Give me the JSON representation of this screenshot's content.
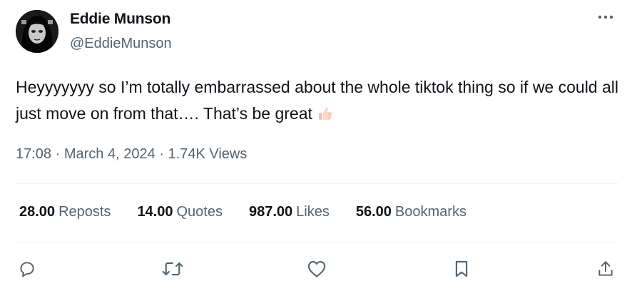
{
  "author": {
    "display_name": "Eddie Munson",
    "handle": "@EddieMunson",
    "avatar": "avatar-image"
  },
  "tweet": {
    "text": "Heyyyyyyy so I’m totally embarrassed about the whole tiktok thing so if we could all just move on from that…. That’s be great",
    "emoji": "thumbs-up-icon"
  },
  "meta": {
    "time": "17:08",
    "separator": "·",
    "date": "March 4, 2024",
    "views": "1.74K",
    "views_label": "Views"
  },
  "stats": [
    {
      "value": "28.00",
      "label": "Reposts"
    },
    {
      "value": "14.00",
      "label": "Quotes"
    },
    {
      "value": "987.00",
      "label": "Likes"
    },
    {
      "value": "56.00",
      "label": "Bookmarks"
    }
  ],
  "actions": [
    "reply-icon",
    "retweet-icon",
    "like-icon",
    "bookmark-icon",
    "share-icon"
  ],
  "colors": {
    "text_primary": "#0f1419",
    "text_secondary": "#536471",
    "divider": "#eff3f4"
  }
}
